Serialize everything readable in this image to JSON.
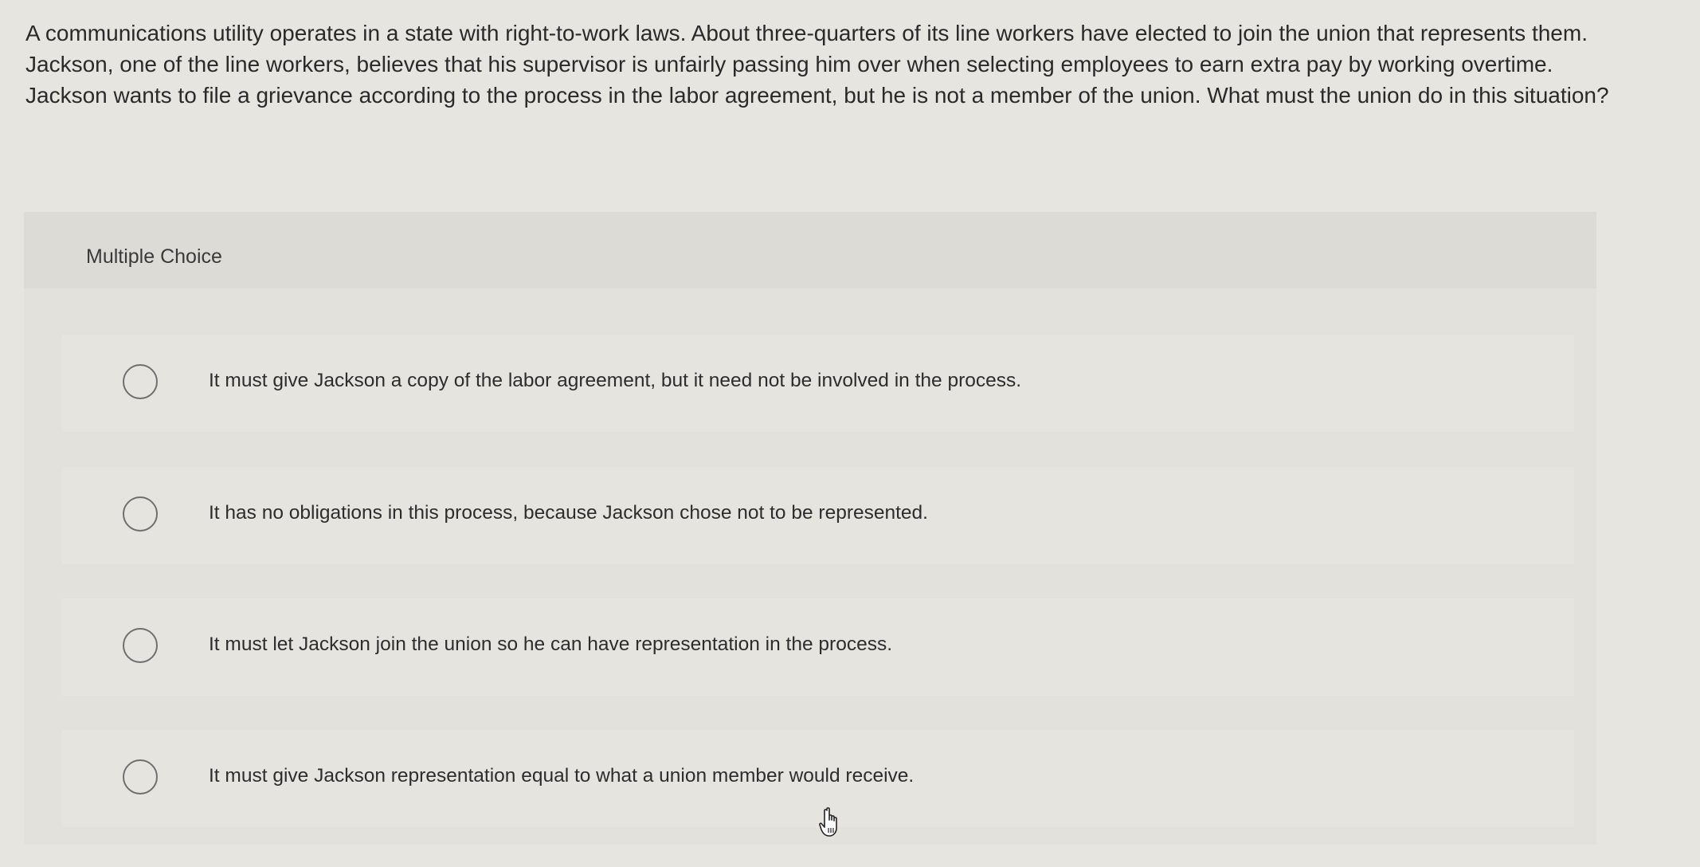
{
  "question": {
    "text": "A communications utility operates in a state with right-to-work laws. About three-quarters of its line workers have elected to join the union that represents them. Jackson, one of the line workers, believes that his supervisor is unfairly passing him over when selecting employees to earn extra pay by working overtime. Jackson wants to file a grievance according to the process in the labor agreement, but he is not a member of the union. What must the union do in this situation?"
  },
  "multiple_choice": {
    "title": "Multiple Choice",
    "options": [
      {
        "label": "It must give Jackson a copy of the labor agreement, but it need not be involved in the process.",
        "selected": false
      },
      {
        "label": "It has no obligations in this process, because Jackson chose not to be represented.",
        "selected": false
      },
      {
        "label": "It must let Jackson join the union so he can have representation in the process.",
        "selected": false
      },
      {
        "label": "It must give Jackson representation equal to what a union member would receive.",
        "selected": false
      }
    ]
  },
  "icons": {
    "radio": "radio-button-icon",
    "cursor": "hand-pointer-icon"
  }
}
